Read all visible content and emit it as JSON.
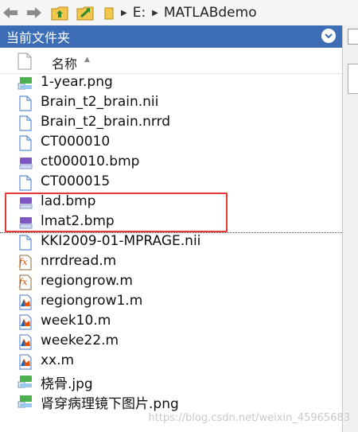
{
  "address": {
    "drive": "E:",
    "folder": "MATLABdemo"
  },
  "panel": {
    "title": "当前文件夹"
  },
  "columns": {
    "name": "名称"
  },
  "files": [
    {
      "name": "1-year.png",
      "icon": "image-file-icon"
    },
    {
      "name": "Brain_t2_brain.nii",
      "icon": "generic-file-icon"
    },
    {
      "name": "Brain_t2_brain.nrrd",
      "icon": "generic-file-icon"
    },
    {
      "name": "CT000010",
      "icon": "generic-file-icon"
    },
    {
      "name": "ct000010.bmp",
      "icon": "bitmap-file-icon"
    },
    {
      "name": "CT000015",
      "icon": "generic-file-icon"
    },
    {
      "name": "lad.bmp",
      "icon": "bitmap-file-icon"
    },
    {
      "name": "lmat2.bmp",
      "icon": "bitmap-file-icon"
    },
    {
      "name": "KKI2009-01-MPRAGE.nii",
      "icon": "generic-file-icon"
    },
    {
      "name": "nrrdread.m",
      "icon": "function-file-icon"
    },
    {
      "name": "regiongrow.m",
      "icon": "function-file-icon"
    },
    {
      "name": "regiongrow1.m",
      "icon": "script-file-icon"
    },
    {
      "name": "week10.m",
      "icon": "script-file-icon"
    },
    {
      "name": "weeke22.m",
      "icon": "script-file-icon"
    },
    {
      "name": "xx.m",
      "icon": "script-file-icon"
    },
    {
      "name": "桡骨.jpg",
      "icon": "image-file-icon"
    },
    {
      "name": "肾穿病理镜下图片.png",
      "icon": "image-file-icon"
    }
  ],
  "watermark": "https://blog.csdn.net/weixin_45965683",
  "colors": {
    "panel_header": "#3d6eb5",
    "highlight_box": "#e53935"
  }
}
